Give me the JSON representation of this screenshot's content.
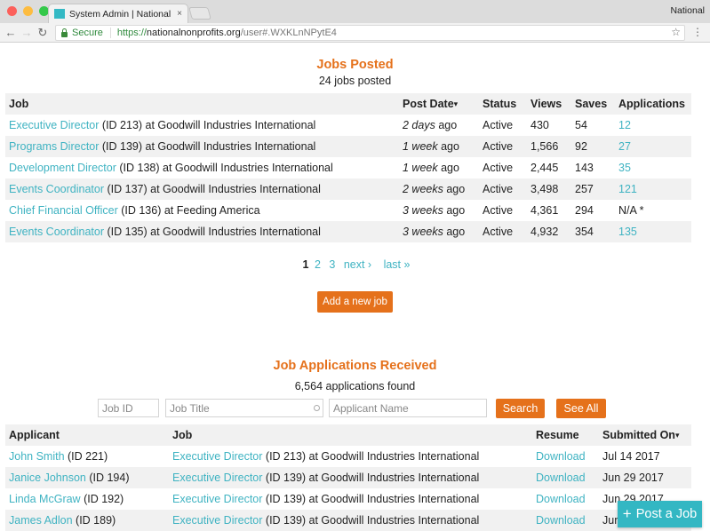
{
  "browser": {
    "tab_title": "System Admin | National Nonpr",
    "tab_close": "×",
    "profile_name": "National",
    "nav_back": "←",
    "nav_forward": "→",
    "reload": "↻",
    "secure_label": "Secure",
    "url_scheme": "https://",
    "url_host": "nationalnonprofits.org",
    "url_path": "/user#.WXKLnNPytE4",
    "bookmark_icon": "☆",
    "menu_icon": "⋮"
  },
  "jobs": {
    "title": "Jobs Posted",
    "count": "24 jobs posted",
    "columns": [
      "Job",
      "Post Date",
      "Status",
      "Views",
      "Saves",
      "Applications"
    ],
    "sort_caret": "▾",
    "rows": [
      {
        "title": "Executive Director",
        "detail": " (ID 213) at Goodwill Industries International",
        "date_em": "2 days",
        "date_rest": " ago",
        "status": "Active",
        "views": "430",
        "saves": "54",
        "applications": "12",
        "app_link": true
      },
      {
        "title": "Programs Director",
        "detail": " (ID 139) at Goodwill Industries International",
        "date_em": "1 week",
        "date_rest": " ago",
        "status": "Active",
        "views": "1,566",
        "saves": "92",
        "applications": "27",
        "app_link": true
      },
      {
        "title": "Development Director",
        "detail": " (ID 138) at Goodwill Industries International",
        "date_em": "1 week",
        "date_rest": " ago",
        "status": "Active",
        "views": "2,445",
        "saves": "143",
        "applications": "35",
        "app_link": true
      },
      {
        "title": "Events Coordinator",
        "detail": " (ID 137) at Goodwill Industries International",
        "date_em": "2 weeks",
        "date_rest": " ago",
        "status": "Active",
        "views": "3,498",
        "saves": "257",
        "applications": "121",
        "app_link": true
      },
      {
        "title": "Chief Financial Officer",
        "detail": " (ID 136) at Feeding America",
        "date_em": "3 weeks",
        "date_rest": " ago",
        "status": "Active",
        "views": "4,361",
        "saves": "294",
        "applications": "N/A *",
        "app_link": false
      },
      {
        "title": "Events Coordinator",
        "detail": " (ID 135) at Goodwill Industries International",
        "date_em": "3 weeks",
        "date_rest": " ago",
        "status": "Active",
        "views": "4,932",
        "saves": "354",
        "applications": "135",
        "app_link": true
      }
    ],
    "pager": {
      "current": "1",
      "pages": [
        "2",
        "3"
      ],
      "next": "next ›",
      "last": "last »"
    },
    "add_button": "Add a new job"
  },
  "applications": {
    "title": "Job Applications Received",
    "count": "6,564 applications found",
    "filters": {
      "job_id_placeholder": "Job ID",
      "job_title_placeholder": "Job Title",
      "applicant_placeholder": "Applicant Name",
      "job_id_value": "",
      "job_title_value": "",
      "applicant_value": ""
    },
    "search_button": "Search",
    "see_all_button": "See All",
    "columns": [
      "Applicant",
      "Job",
      "Resume",
      "Submitted On"
    ],
    "sort_caret": "▾",
    "rows": [
      {
        "name": "John Smith",
        "name_id": " (ID 221)",
        "job": "Executive Director",
        "job_detail": " (ID 213) at Goodwill Industries International",
        "resume": "Download",
        "submitted": "Jul 14 2017"
      },
      {
        "name": "Janice Johnson",
        "name_id": " (ID 194)",
        "job": "Executive Director",
        "job_detail": " (ID 139) at Goodwill Industries International",
        "resume": "Download",
        "submitted": "Jun 29 2017"
      },
      {
        "name": "Linda McGraw",
        "name_id": " (ID 192)",
        "job": "Executive Director",
        "job_detail": " (ID 139) at Goodwill Industries International",
        "resume": "Download",
        "submitted": "Jun 29 2017"
      },
      {
        "name": "James Adlon",
        "name_id": " (ID 189)",
        "job": "Executive Director",
        "job_detail": " (ID 139) at Goodwill Industries International",
        "resume": "Download",
        "submitted": "Jun 29 2017"
      }
    ]
  },
  "fab": {
    "icon": "+",
    "label": "Post a Job"
  },
  "colors": {
    "accent_orange": "#e5711b",
    "link_teal": "#3fb3c2",
    "fab_teal": "#33b7c3",
    "row_stripe": "#f1f1f1"
  }
}
